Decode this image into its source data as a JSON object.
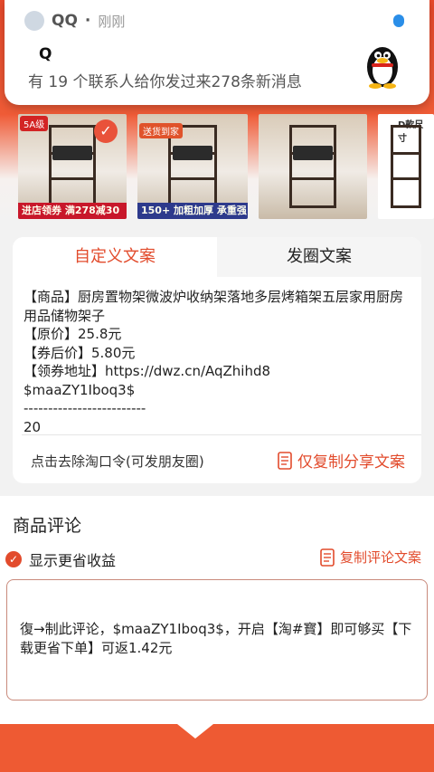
{
  "notification": {
    "app_name": "QQ",
    "time": "刚刚",
    "title": "Q",
    "body": "有 19 个联系人给你发过来278条新消息"
  },
  "thumbs": [
    {
      "tag1": "5A级",
      "bar": "进店领券  满278减30"
    },
    {
      "tag1": "送货到家",
      "bar": "150+  加粗加厚  承重强"
    },
    {
      "tag1": "",
      "bar": ""
    },
    {
      "tag1": "D款尺寸",
      "bar": ""
    }
  ],
  "tabs": {
    "custom": "自定义文案",
    "moments": "发圈文案"
  },
  "copy": {
    "text": "【商品】厨房置物架微波炉收纳架落地多层烤箱架五层家用厨房用品储物架子\n【原价】25.8元\n【券后价】5.80元\n【领券地址】https://dwz.cn/AqZhihd8\n$maaZY1Iboq3$\n-------------------------\n20"
  },
  "actions": {
    "remove_command": "点击去除淘口令(可发朋友圈)",
    "copy_share": "仅复制分享文案"
  },
  "comments": {
    "title": "商品评论",
    "show_savings": "显示更省收益",
    "copy_comment": "复制评论文案",
    "comment_text": "復→制此评论，$maaZY1Iboq3$，开启【淘#寳】即可够买【下载更省下单】可返1.42元"
  },
  "colors": {
    "accent": "#e24b2c",
    "header": "#ee5a33"
  }
}
